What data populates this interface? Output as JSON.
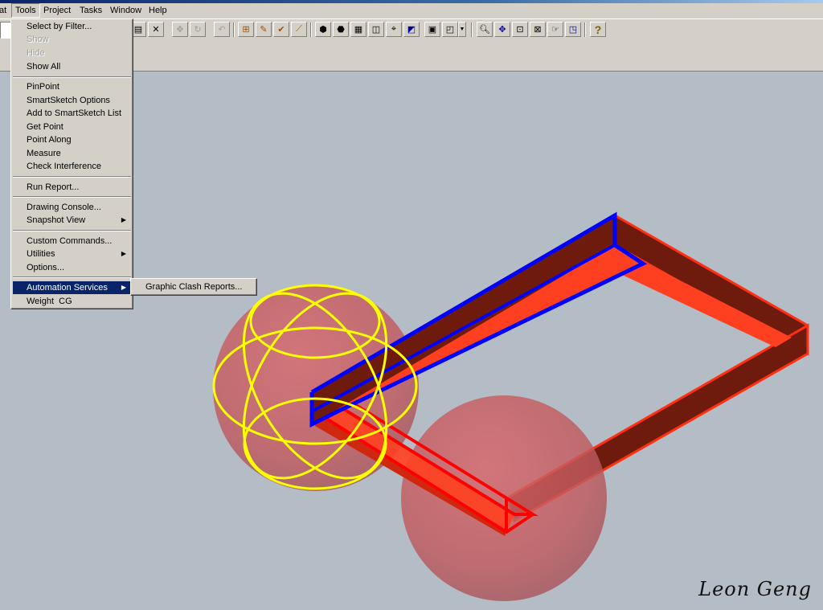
{
  "menubar": {
    "items": [
      "at",
      "Tools",
      "Project",
      "Tasks",
      "Window",
      "Help"
    ]
  },
  "toolbar": {
    "icons": [
      "paste-icon",
      "delete-icon",
      "pan-icon",
      "rotate-icon",
      "undo-icon",
      "select-icon",
      "edit-icon",
      "check-icon",
      "measure-icon",
      "view-front-icon",
      "view-back-icon",
      "view-top-icon",
      "view-iso-icon",
      "view-camera-icon",
      "view-section-icon",
      "render-icon",
      "zoom-icon",
      "pan-view-icon",
      "zoom-area-icon",
      "zoom-fit-icon",
      "fly-icon",
      "window-icon",
      "help-icon"
    ],
    "help_label": "?"
  },
  "tools_menu": {
    "items": [
      {
        "label": "Select by Filter...",
        "state": "enabled"
      },
      {
        "label": "Show",
        "state": "disabled"
      },
      {
        "label": "Hide",
        "state": "disabled"
      },
      {
        "label": "Show All",
        "state": "enabled"
      },
      {
        "label": "PinPoint",
        "state": "enabled"
      },
      {
        "label": "SmartSketch Options",
        "state": "enabled"
      },
      {
        "label": "Add to SmartSketch List",
        "state": "enabled"
      },
      {
        "label": "Get Point",
        "state": "enabled"
      },
      {
        "label": "Point Along",
        "state": "enabled"
      },
      {
        "label": "Measure",
        "state": "enabled"
      },
      {
        "label": "Check Interference",
        "state": "enabled"
      },
      {
        "label": "Run Report...",
        "state": "enabled"
      },
      {
        "label": "Drawing Console...",
        "state": "enabled"
      },
      {
        "label": "Snapshot View",
        "state": "submenu"
      },
      {
        "label": "Custom Commands...",
        "state": "enabled"
      },
      {
        "label": "Utilities",
        "state": "submenu"
      },
      {
        "label": "Options...",
        "state": "enabled"
      },
      {
        "label": "Automation Services",
        "state": "highlighted-submenu"
      },
      {
        "label": "Weight  CG",
        "state": "enabled"
      }
    ],
    "submenu_arrow": "▶"
  },
  "automation_submenu": {
    "items": [
      "Graphic Clash Reports..."
    ]
  },
  "scene": {
    "background_color": "#b4bcc6",
    "beam_color": "#ff4020",
    "beam_dark_color": "#6e1a0c",
    "highlight_color": "#0000ff",
    "selection_color": "#ff0000",
    "clash_sphere_color": "#c85a5e",
    "clash_marker_color": "#ffff00"
  },
  "signature": "Leon Geng"
}
